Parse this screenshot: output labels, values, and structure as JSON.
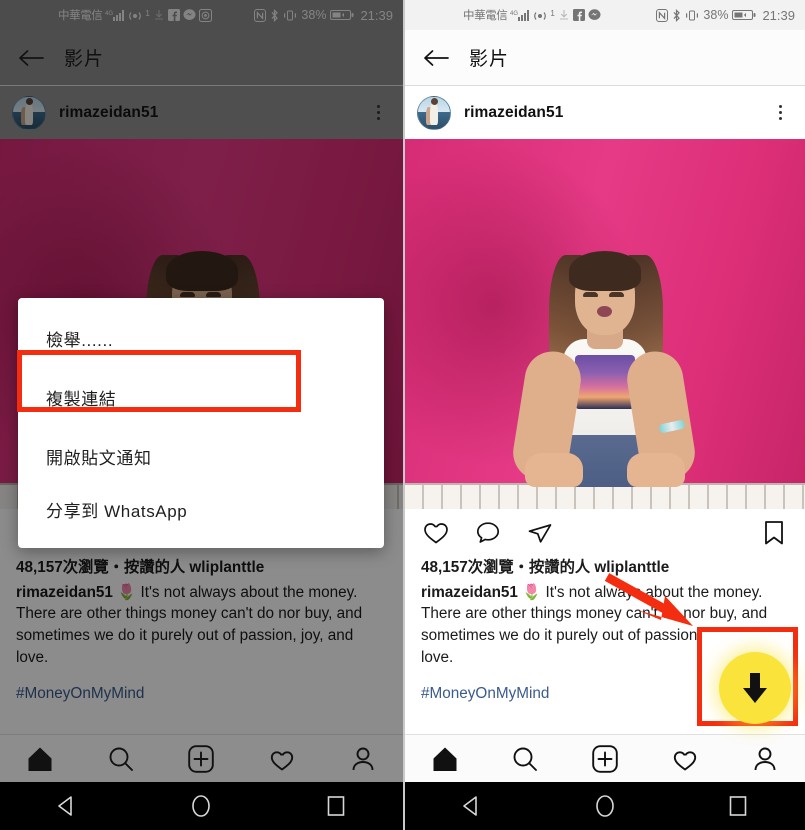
{
  "status_bar": {
    "carrier": "中華電信",
    "network": "4G",
    "superscript": "1",
    "icons": [
      "signal-icon",
      "hotspot-icon",
      "download-icon",
      "facebook-icon",
      "messenger-icon"
    ],
    "right_icons": [
      "nfc-icon",
      "bluetooth-icon",
      "vibrate-icon"
    ],
    "battery_percent": "38%",
    "time": "21:39"
  },
  "app_bar": {
    "back_label": "back-arrow",
    "title": "影片"
  },
  "post_header": {
    "username": "rimazeidan51",
    "menu_label": "more-options"
  },
  "actions": {
    "like": "like",
    "comment": "comment",
    "share": "share",
    "save": "save"
  },
  "caption": {
    "views": "48,157次瀏覽・按讚的人 wliplanttle",
    "username": "rimazeidan51",
    "emoji": "🌷",
    "text": "It's not always about the money. There are other things money can't do nor buy, and sometimes we do it purely out of passion, joy, and love.",
    "hashtag": "#MoneyOnMyMind"
  },
  "dialog": {
    "items": [
      {
        "label": "檢舉......",
        "highlighted": false
      },
      {
        "label": "複製連結",
        "highlighted": true
      },
      {
        "label": "開啟貼文通知",
        "highlighted": false
      },
      {
        "label": "分享到 WhatsApp",
        "highlighted": false
      }
    ]
  },
  "tabbar": {
    "items": [
      "home-icon",
      "search-icon",
      "add-post-icon",
      "activity-icon",
      "profile-icon"
    ]
  },
  "navbar": {
    "items": [
      "back-nav-icon",
      "home-nav-icon",
      "recents-nav-icon"
    ]
  },
  "annotations": {
    "highlight_color": "#f42d10",
    "download_button_color": "#fae33a",
    "download_button_label": "download-arrow",
    "arrow_label": "pointer-arrow"
  }
}
